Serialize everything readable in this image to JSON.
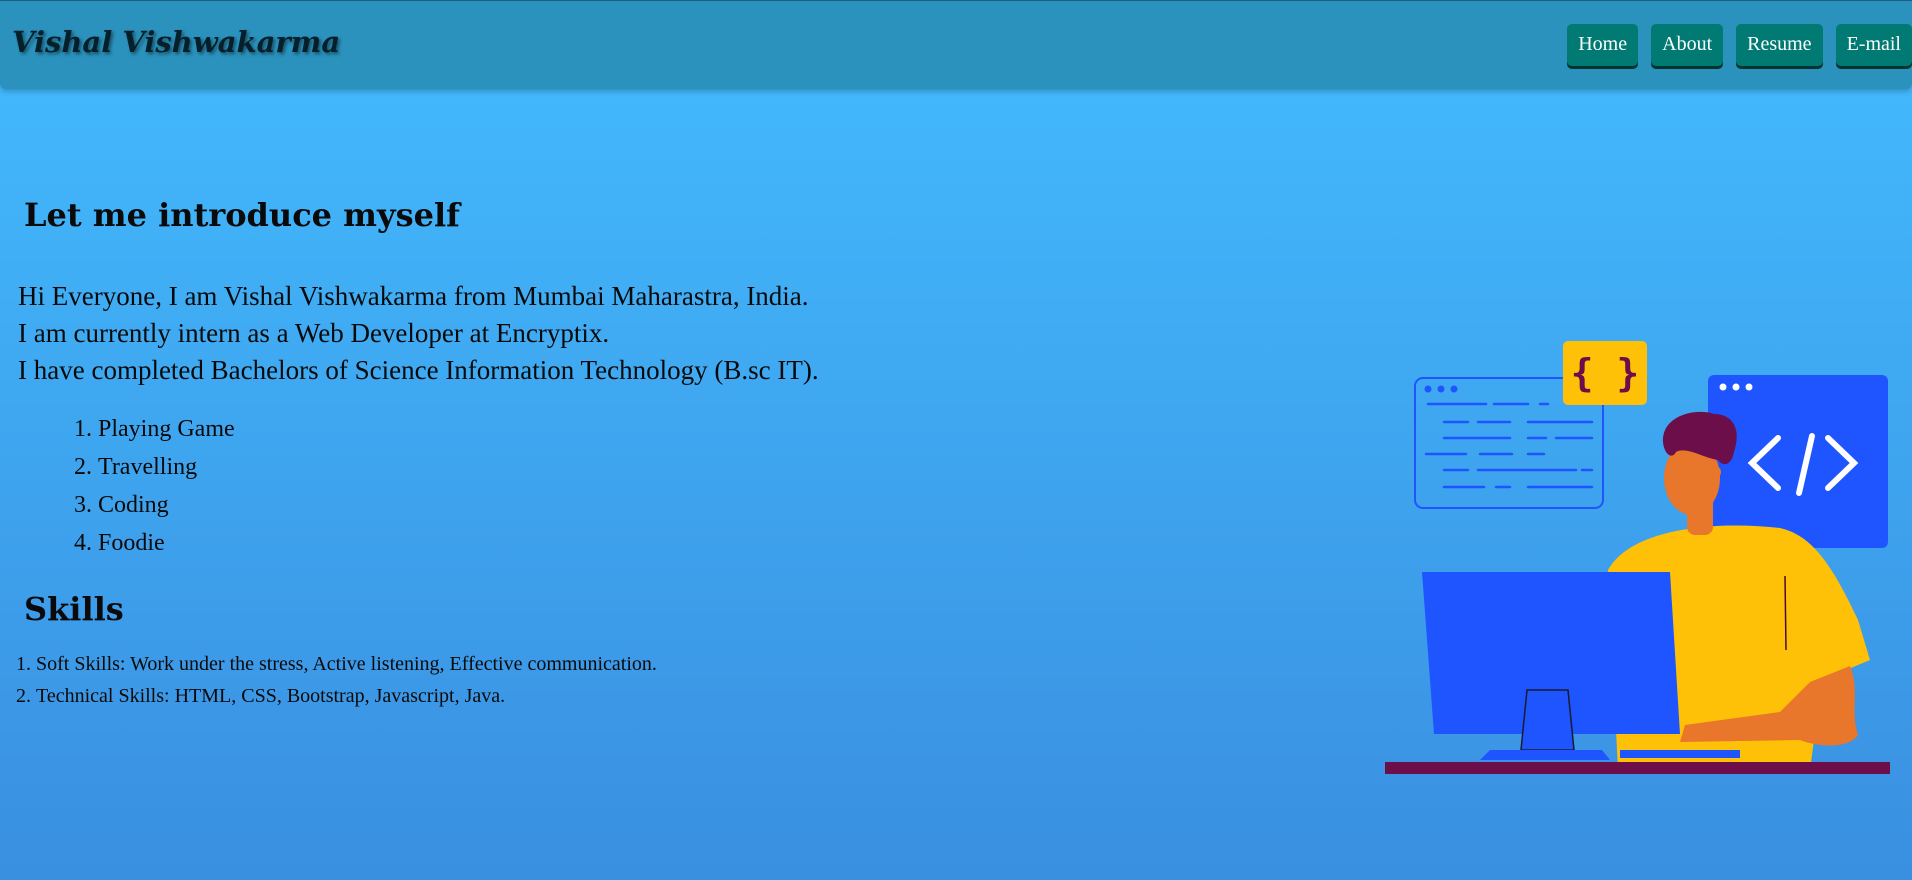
{
  "brand": {
    "name": "Vishal Vishwakarma"
  },
  "nav": {
    "items": [
      "Home",
      "About",
      "Resume",
      "E-mail"
    ]
  },
  "intro": {
    "title": "Let me introduce myself",
    "lines": [
      "Hi Everyone, I am Vishal Vishwakarma from Mumbai Maharastra, India.",
      "I am currently intern as a Web Developer at Encryptix.",
      "I have completed Bachelors of Science Information Technology (B.sc IT)."
    ],
    "hobbies": [
      "Playing Game",
      "Travelling",
      "Coding",
      "Foodie"
    ]
  },
  "skills": {
    "title": "Skills",
    "items": [
      "Soft Skills: Work under the stress, Active listening, Effective communication.",
      "Technical Skills: HTML, CSS, Bootstrap, Javascript, Java."
    ]
  },
  "illustration": {
    "braces_symbol": "{ }",
    "code_symbol": "</>",
    "colors": {
      "blue": "#1f55ff",
      "yellow": "#ffc107",
      "skin": "#e8762b",
      "hair": "#6b0e4a",
      "desk": "#6b0e4a"
    }
  },
  "colors": {
    "navbar": "#2a92bc",
    "nav_button": "#007a72",
    "background_top": "#43bcff",
    "background_bottom": "#3a8fe0"
  }
}
